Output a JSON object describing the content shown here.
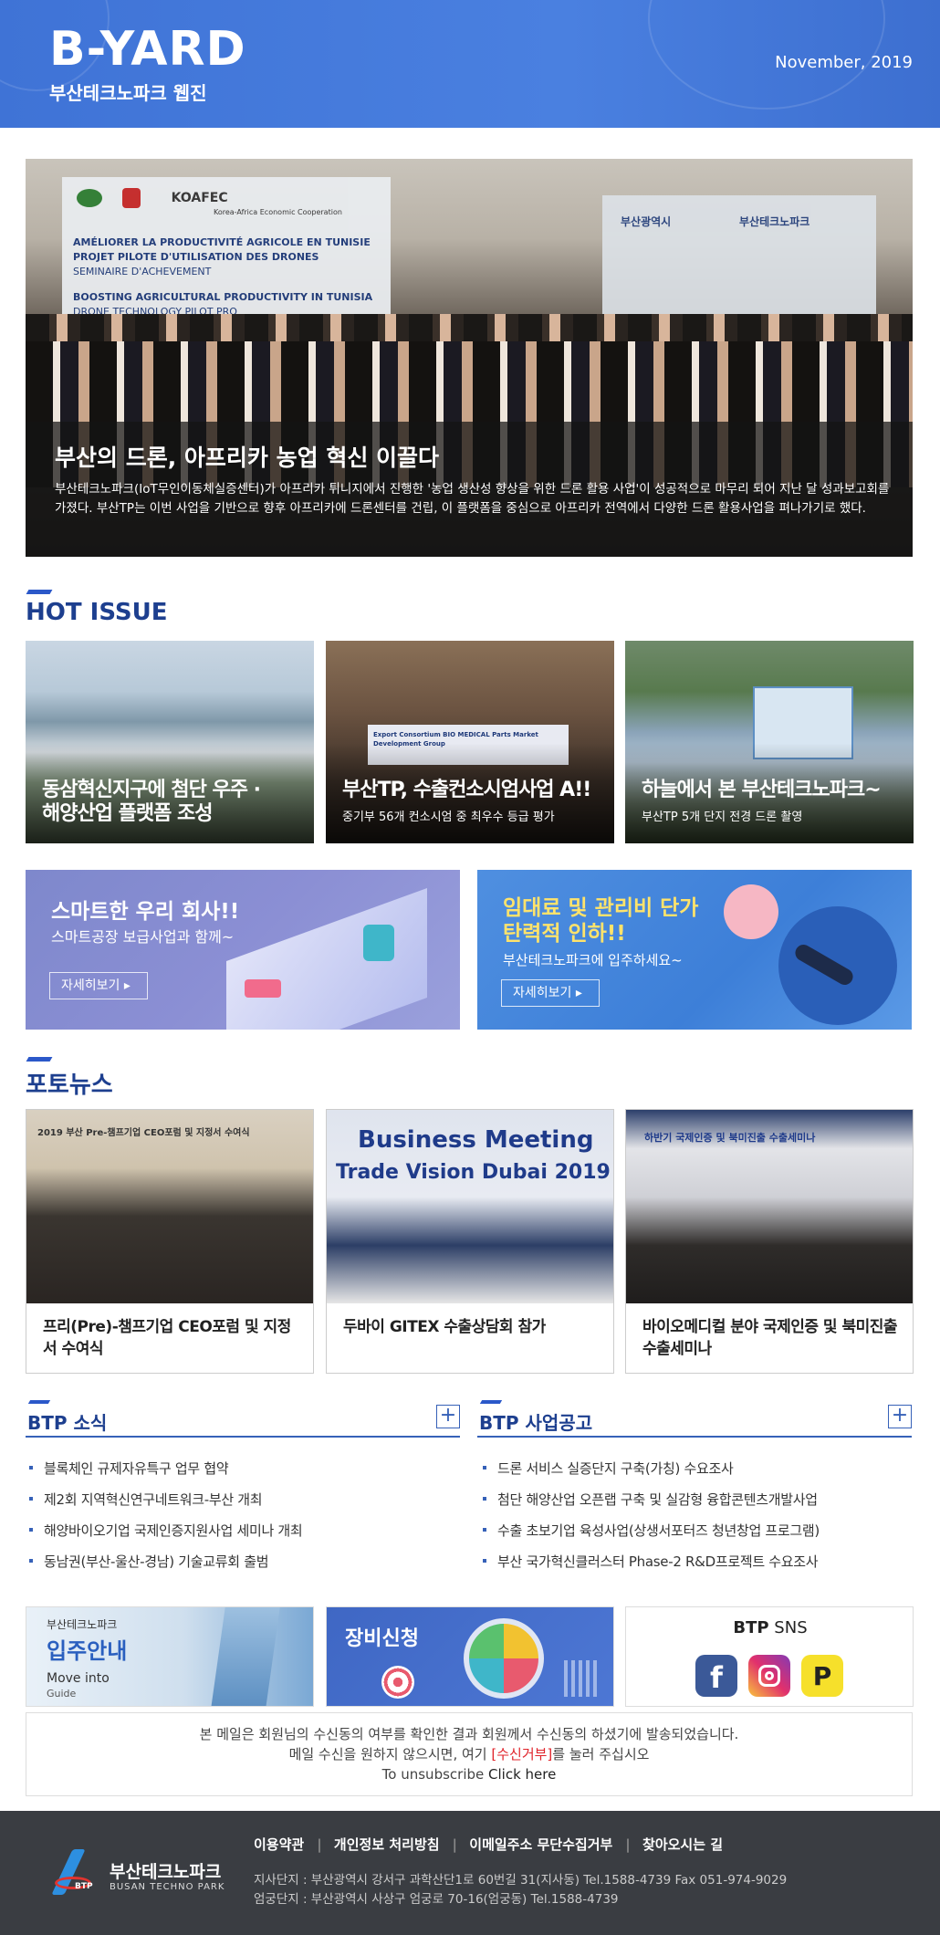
{
  "header": {
    "logo": "B-YARD",
    "subtitle": "부산테크노파크 웹진",
    "date": "November, 2019"
  },
  "hero": {
    "title": "부산의 드론, 아프리카 농업 혁신 이끌다",
    "body": "부산테크노파크(IoT무인이동체실증센터)가 아프리카 튀니지에서 진행한 '농업 생산성 향상을 위한 드론 활용 사업'이 성공적으로 마무리 되어 지난 달 성과보고회를 가졌다. 부산TP는 이번 사업을 기반으로 향후 아프리카에 드론센터를 건립, 이 플랫폼을 중심으로 아프리카 전역에서 다양한 드론 활용사업을 펴나가기로 했다.",
    "banner_lines": [
      "AMÉLIORER LA PRODUCTIVITÉ AGRICOLE EN TUNISIE",
      "PROJET PILOTE D'UTILISATION DES DRONES",
      "SEMINAIRE D'ACHEVEMENT",
      "BOOSTING AGRICULTURAL PRODUCTIVITY IN TUNISIA",
      "DRONE TECHNOLOGY PILOT PRO"
    ],
    "banner_logo": "KOAFEC",
    "banner_logo_sub": "Korea-Africa Economic Cooperation",
    "right_logo1": "부산광역시",
    "right_logo2": "부산테크노파크"
  },
  "hot_issue": {
    "title": "HOT ISSUE",
    "cards": [
      {
        "title_line1": "동삼혁신지구에 첨단 우주 ·",
        "title_line2": "해양산업 플랫폼 조성",
        "sub": ""
      },
      {
        "title_line1": "부산TP, 수출컨소시엄사업 A!!",
        "title_line2": "",
        "sub": "중기부 56개 컨소시엄 중 최우수 등급 평가"
      },
      {
        "title_line1": "하늘에서 본 부산테크노파크~",
        "title_line2": "",
        "sub": "부산TP 5개 단지 전경 드론 촬영"
      }
    ],
    "card2_banner": "Export Consortium BIO MEDICAL Parts Market Development Group"
  },
  "banners": [
    {
      "line1": "스마트한 우리 회사!!",
      "line2": "스마트공장 보급사업과 함께~",
      "button": "자세히보기 ▸"
    },
    {
      "line1": "임대료 및 관리비 단가",
      "line2": "탄력적 인하!!",
      "line3": "부산테크노파크에 입주하세요~",
      "button": "자세히보기 ▸"
    }
  ],
  "photo_news": {
    "title": "포토뉴스",
    "cards": [
      {
        "title": "프리(Pre)-챔프기업 CEO포럼 및 지정서 수여식",
        "img_text": "2019 부산 Pre-챔프기업 CEO포럼 및 지정서 수여식"
      },
      {
        "title": "두바이 GITEX 수출상담회 참가",
        "img_text1": "Business Meeting",
        "img_text2": "Trade Vision Dubai 2019"
      },
      {
        "title": "바이오메디컬 분야 국제인증 및 북미진출 수출세미나",
        "img_text": "하반기 국제인증 및 북미진출 수출세미나"
      }
    ]
  },
  "btp_news": {
    "title": "BTP 소식",
    "plus": "+",
    "items": [
      "블록체인 규제자유특구 업무 협약",
      "제2회 지역혁신연구네트워크-부산 개최",
      "해양바이오기업 국제인증지원사업 세미나 개최",
      "동남권(부산-울산-경남) 기술교류회 출범"
    ]
  },
  "btp_notice": {
    "title": "BTP 사업공고",
    "plus": "+",
    "items": [
      "드론 서비스 실증단지 구축(가칭) 수요조사",
      "첨단 해양산업 오픈랩 구축 및 실감형 융합콘텐츠개발사업",
      "수출 초보기업 육성사업(상생서포터즈 청년창업 프로그램)",
      "부산 국가혁신클러스터 Phase-2 R&D프로젝트 수요조사"
    ]
  },
  "tiles": {
    "move": {
      "top": "부산테크노파크",
      "main": "입주안내",
      "en1": "Move into",
      "en2": "Guide"
    },
    "equip": {
      "label": "장비신청"
    },
    "sns": {
      "label_bold": "BTP",
      "label": " SNS"
    }
  },
  "notice": {
    "line1": "본 메일은 회원님의 수신동의 여부를 확인한 결과 회원께서 수신동의 하셨기에 발송되었습니다.",
    "line2a": "메일 수신을 원하지 않으시면, 여기 ",
    "line2b": "[수신거부]",
    "line2c": "를 눌러 주십시오",
    "line3a": "To unsubscribe ",
    "line3b": "Click here"
  },
  "footer": {
    "links": [
      "이용약관",
      "개인정보 처리방침",
      "이메일주소 무단수집거부",
      "찾아오시는 길"
    ],
    "addr1": "지사단지 : 부산광역시 강서구 과학산단1로 60번길 31(지사동) Tel.1588-4739 Fax 051-974-9029",
    "addr2": "엄궁단지 : 부산광역시 사상구 엄궁로 70-16(엄궁동) Tel.1588-4739",
    "logo_name": "부산테크노파크",
    "logo_en": "BUSAN TECHNO PARK",
    "logo_mark": "BTP"
  },
  "colors": {
    "brand_blue": "#3f73d6",
    "title_blue": "#1d3f8f",
    "red": "#e0232a",
    "footer_bg": "#3a3d42"
  }
}
